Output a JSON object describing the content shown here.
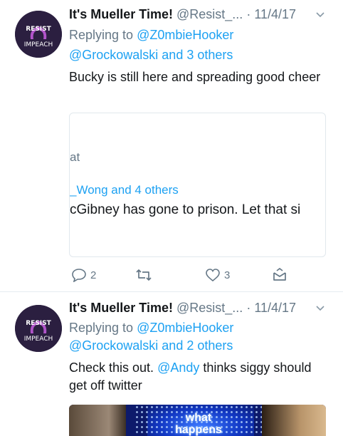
{
  "tweets": [
    {
      "author_name": "It's Mueller Time!",
      "handle": "@Resist_...",
      "separator": "·",
      "date": "11/4/17",
      "avatar_text_top": "RESIST",
      "avatar_text_bottom": "IMPEACH",
      "replying_prefix": "Replying to ",
      "replying_to": "@Z0mbieHooker",
      "replying_more": "@Grockowalski and 3 others",
      "text": "Bucky is still here and spreading good cheer",
      "quote": {
        "line1": "at",
        "line2": "_Wong and 4 others",
        "line3": "cGibney has gone to prison. Let that si"
      },
      "actions": {
        "reply_count": "2",
        "retweet_count": "",
        "like_count": "3"
      }
    },
    {
      "author_name": "It's Mueller Time!",
      "handle": "@Resist_...",
      "separator": "·",
      "date": "11/4/17",
      "avatar_text_top": "RESIST",
      "avatar_text_bottom": "IMPEACH",
      "replying_prefix": "Replying to ",
      "replying_to": "@Z0mbieHooker",
      "replying_more": "@Grockowalski and 2 others",
      "text_before": "Check this out. ",
      "text_mention": "@Andy",
      "text_after": " thinks siggy should get off twitter",
      "media_caption": "what happens"
    }
  ],
  "colors": {
    "link": "#1da1f2",
    "secondary": "#657786",
    "primary_text": "#14171a",
    "divider": "#e6ecf0"
  },
  "icons": [
    "reply-icon",
    "retweet-icon",
    "like-icon",
    "share-icon",
    "caret-down-icon"
  ]
}
